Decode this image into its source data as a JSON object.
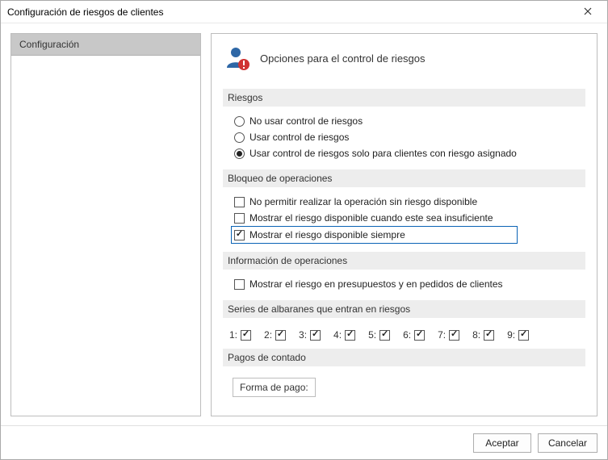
{
  "window": {
    "title": "Configuración de riesgos de clientes"
  },
  "sidebar": {
    "items": [
      {
        "label": "Configuración"
      }
    ]
  },
  "heading": "Opciones para el control de riesgos",
  "sections": {
    "riesgos": {
      "label": "Riesgos",
      "options": [
        {
          "label": "No usar control de riesgos",
          "checked": false
        },
        {
          "label": "Usar control de riesgos",
          "checked": false
        },
        {
          "label": "Usar control de riesgos solo para clientes con riesgo asignado",
          "checked": true
        }
      ]
    },
    "bloqueo": {
      "label": "Bloqueo de operaciones",
      "options": [
        {
          "label": "No permitir realizar la operación sin riesgo disponible",
          "checked": false
        },
        {
          "label": "Mostrar el riesgo disponible cuando este sea insuficiente",
          "checked": false
        },
        {
          "label": "Mostrar el riesgo disponible siempre",
          "checked": true,
          "focused": true
        }
      ]
    },
    "informacion": {
      "label": "Información de operaciones",
      "options": [
        {
          "label": "Mostrar el riesgo en presupuestos y en pedidos de clientes",
          "checked": false
        }
      ]
    },
    "series": {
      "label": "Series de albaranes que entran en riesgos",
      "items": [
        {
          "n": "1:",
          "checked": true
        },
        {
          "n": "2:",
          "checked": true
        },
        {
          "n": "3:",
          "checked": true
        },
        {
          "n": "4:",
          "checked": true
        },
        {
          "n": "5:",
          "checked": true
        },
        {
          "n": "6:",
          "checked": true
        },
        {
          "n": "7:",
          "checked": true
        },
        {
          "n": "8:",
          "checked": true
        },
        {
          "n": "9:",
          "checked": true
        }
      ]
    },
    "pagos": {
      "label": "Pagos de contado",
      "field_label": "Forma de pago:",
      "field_value": ""
    }
  },
  "buttons": {
    "accept": "Aceptar",
    "cancel": "Cancelar"
  }
}
